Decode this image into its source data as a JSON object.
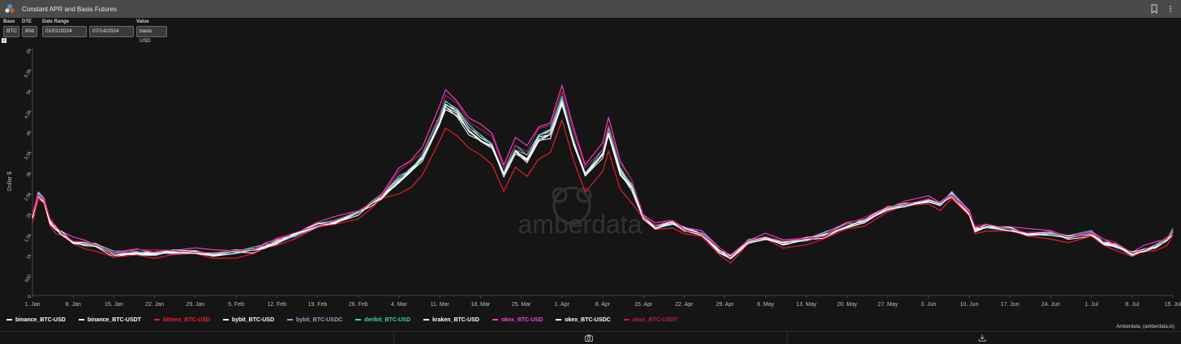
{
  "window": {
    "title": "Constant APR and Basis Futures"
  },
  "controls": {
    "base": {
      "label": "Base",
      "value": "BTC"
    },
    "dte": {
      "label": "DTE",
      "value": "90d"
    },
    "date_range": {
      "label": "Date Range",
      "start": "01/01/2024",
      "end": "07/14/2024"
    },
    "value": {
      "label": "Value",
      "value": "basis USD"
    },
    "index_badge": "1"
  },
  "chart_data": {
    "type": "line",
    "ylabel": "Dollar $",
    "yticks": [
      0,
      500,
      1000,
      1500,
      2000,
      2500,
      3000,
      3500,
      4000,
      4500,
      5000,
      5500,
      6000
    ],
    "ytick_labels": [
      "0",
      "500",
      "1k",
      "1,5k",
      "2k",
      "2,5k",
      "3k",
      "3,5k",
      "4k",
      "4,5k",
      "5k",
      "5,5k",
      "6k"
    ],
    "ylim": [
      0,
      6000
    ],
    "xlim": [
      "2024-01-01",
      "2024-07-15"
    ],
    "xtick_labels": [
      "1. Jan",
      "8. Jan",
      "15. Jan",
      "22. Jan",
      "29. Jan",
      "5. Feb",
      "12. Feb",
      "19. Feb",
      "26. Feb",
      "4. Mar",
      "11. Mar",
      "18. Mar",
      "25. Mar",
      "1. Apr",
      "8. Apr",
      "15. Apr",
      "22. Apr",
      "29. Apr",
      "6. May",
      "13. May",
      "20. May",
      "27. May",
      "3. Jun",
      "10. Jun",
      "17. Jun",
      "24. Jun",
      "1. Jul",
      "8. Jul",
      "15. Jul"
    ],
    "xtick_dates": [
      "2024-01-01",
      "2024-01-08",
      "2024-01-15",
      "2024-01-22",
      "2024-01-29",
      "2024-02-05",
      "2024-02-12",
      "2024-02-19",
      "2024-02-26",
      "2024-03-04",
      "2024-03-11",
      "2024-03-18",
      "2024-03-25",
      "2024-04-01",
      "2024-04-08",
      "2024-04-15",
      "2024-04-22",
      "2024-04-29",
      "2024-05-06",
      "2024-05-13",
      "2024-05-20",
      "2024-05-27",
      "2024-06-03",
      "2024-06-10",
      "2024-06-17",
      "2024-06-24",
      "2024-07-01",
      "2024-07-08",
      "2024-07-15"
    ],
    "grid": false,
    "watermark": "amberdata",
    "legend_position": "bottom",
    "base_curve": {
      "dates": [
        "2024-01-01",
        "2024-01-02",
        "2024-01-03",
        "2024-01-04",
        "2024-01-05",
        "2024-01-06",
        "2024-01-08",
        "2024-01-10",
        "2024-01-12",
        "2024-01-15",
        "2024-01-19",
        "2024-01-22",
        "2024-01-25",
        "2024-01-29",
        "2024-02-01",
        "2024-02-05",
        "2024-02-08",
        "2024-02-10",
        "2024-02-12",
        "2024-02-15",
        "2024-02-19",
        "2024-02-22",
        "2024-02-26",
        "2024-02-28",
        "2024-03-01",
        "2024-03-04",
        "2024-03-06",
        "2024-03-08",
        "2024-03-11",
        "2024-03-12",
        "2024-03-14",
        "2024-03-16",
        "2024-03-18",
        "2024-03-20",
        "2024-03-22",
        "2024-03-24",
        "2024-03-26",
        "2024-03-28",
        "2024-03-30",
        "2024-04-01",
        "2024-04-03",
        "2024-04-05",
        "2024-04-08",
        "2024-04-09",
        "2024-04-11",
        "2024-04-13",
        "2024-04-15",
        "2024-04-17",
        "2024-04-20",
        "2024-04-22",
        "2024-04-25",
        "2024-04-28",
        "2024-04-30",
        "2024-05-03",
        "2024-05-06",
        "2024-05-09",
        "2024-05-13",
        "2024-05-16",
        "2024-05-20",
        "2024-05-23",
        "2024-05-27",
        "2024-05-30",
        "2024-06-03",
        "2024-06-05",
        "2024-06-07",
        "2024-06-10",
        "2024-06-11",
        "2024-06-13",
        "2024-06-17",
        "2024-06-20",
        "2024-06-24",
        "2024-06-27",
        "2024-07-01",
        "2024-07-03",
        "2024-07-05",
        "2024-07-08",
        "2024-07-10",
        "2024-07-12",
        "2024-07-14",
        "2024-07-15"
      ],
      "values": [
        1900,
        2450,
        2300,
        1800,
        1600,
        1500,
        1300,
        1250,
        1200,
        1000,
        1050,
        1000,
        1050,
        1050,
        1000,
        1050,
        1100,
        1200,
        1300,
        1450,
        1700,
        1800,
        2000,
        2200,
        2400,
        2800,
        3000,
        3300,
        4200,
        4600,
        4400,
        4000,
        3800,
        3600,
        2900,
        3500,
        3300,
        3800,
        3900,
        4700,
        3700,
        2900,
        3400,
        3950,
        3000,
        2600,
        1900,
        1650,
        1750,
        1600,
        1500,
        1100,
        900,
        1300,
        1400,
        1250,
        1350,
        1450,
        1700,
        1800,
        2100,
        2200,
        2300,
        2200,
        2450,
        2000,
        1600,
        1650,
        1600,
        1500,
        1500,
        1400,
        1500,
        1300,
        1200,
        1000,
        1100,
        1200,
        1350,
        1550
      ]
    },
    "series": [
      {
        "name": "binance_BTC-USD",
        "color": "#ffffff",
        "offset": 0
      },
      {
        "name": "binance_BTC-USDT",
        "color": "#f2f2f2",
        "offset": -20
      },
      {
        "name": "bitmex_BTC-USD",
        "color": "#ff1a2e",
        "offset": -230
      },
      {
        "name": "bybit_BTC-USD",
        "color": "#ffffff",
        "offset": 30
      },
      {
        "name": "bybit_BTC-USDC",
        "color": "#9b9ec4",
        "offset": 40
      },
      {
        "name": "deribit_BTC-USD",
        "color": "#36d6c0",
        "offset": 60
      },
      {
        "name": "kraken_BTC-USD",
        "color": "#ffffff",
        "offset": 10
      },
      {
        "name": "okex_BTC-USD",
        "color": "#ff3fd3",
        "offset": 180
      },
      {
        "name": "okex_BTC-USDC",
        "color": "#ffffff",
        "offset": -10
      },
      {
        "name": "okex_BTC-USDT",
        "color": "#c2185b",
        "offset": 120
      }
    ]
  },
  "footer": {
    "credit": "Amberdata, (amberdata.io)"
  }
}
